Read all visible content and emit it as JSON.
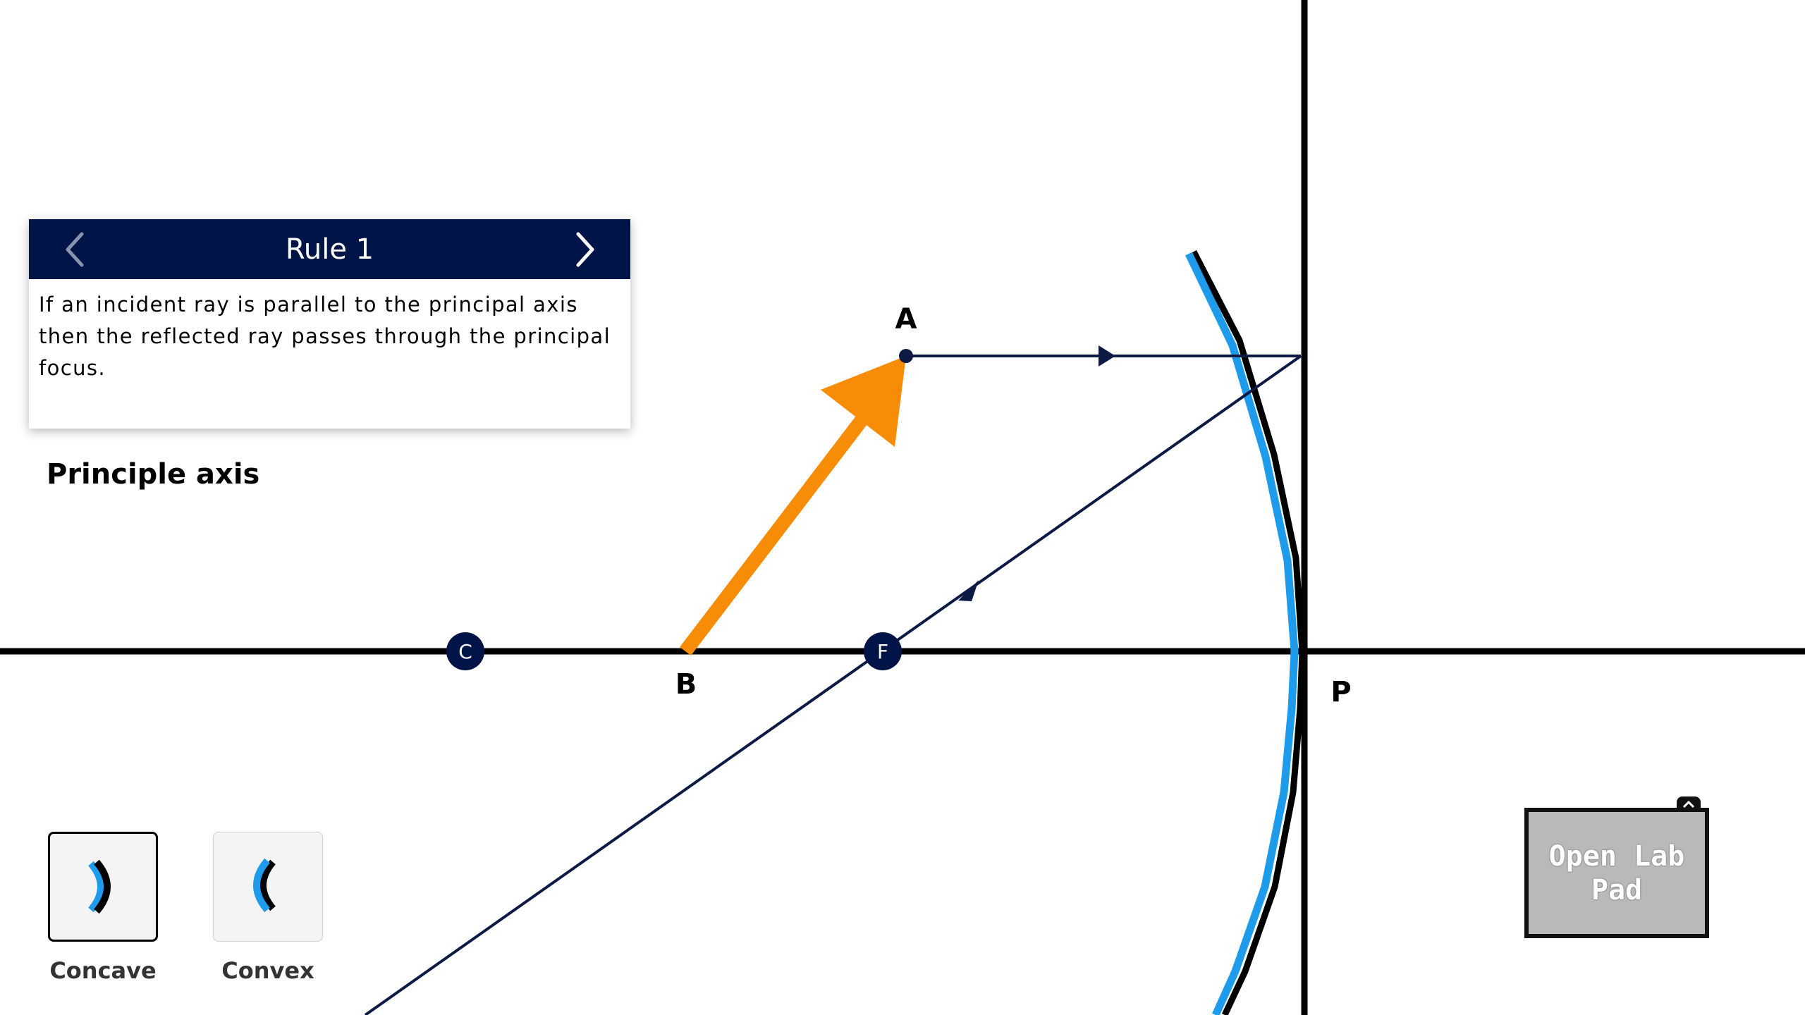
{
  "rule_card": {
    "title": "Rule 1",
    "text": "If an incident ray is parallel to the principal axis then the reflected ray passes through the principal focus.",
    "prev_icon": "chevron-left-icon",
    "next_icon": "chevron-right-icon"
  },
  "axis_label": "Principle axis",
  "points": {
    "c": "C",
    "f": "F",
    "a": "A",
    "b": "B",
    "p": "P"
  },
  "mirror_options": [
    {
      "label": "Concave",
      "selected": true,
      "icon": "concave-mirror-icon"
    },
    {
      "label": "Convex",
      "selected": false,
      "icon": "convex-mirror-icon"
    }
  ],
  "lab_pad": {
    "label": "Open Lab Pad",
    "toggle_icon": "chevron-up-icon"
  },
  "colors": {
    "header_bg": "#001447",
    "object_arrow": "#F78C07",
    "ray": "#0C1A45",
    "mirror_front": "#1E9BEA",
    "mirror_back": "#000000",
    "point_fill": "#001447",
    "lab_pad_bg": "#B9B9B9"
  }
}
